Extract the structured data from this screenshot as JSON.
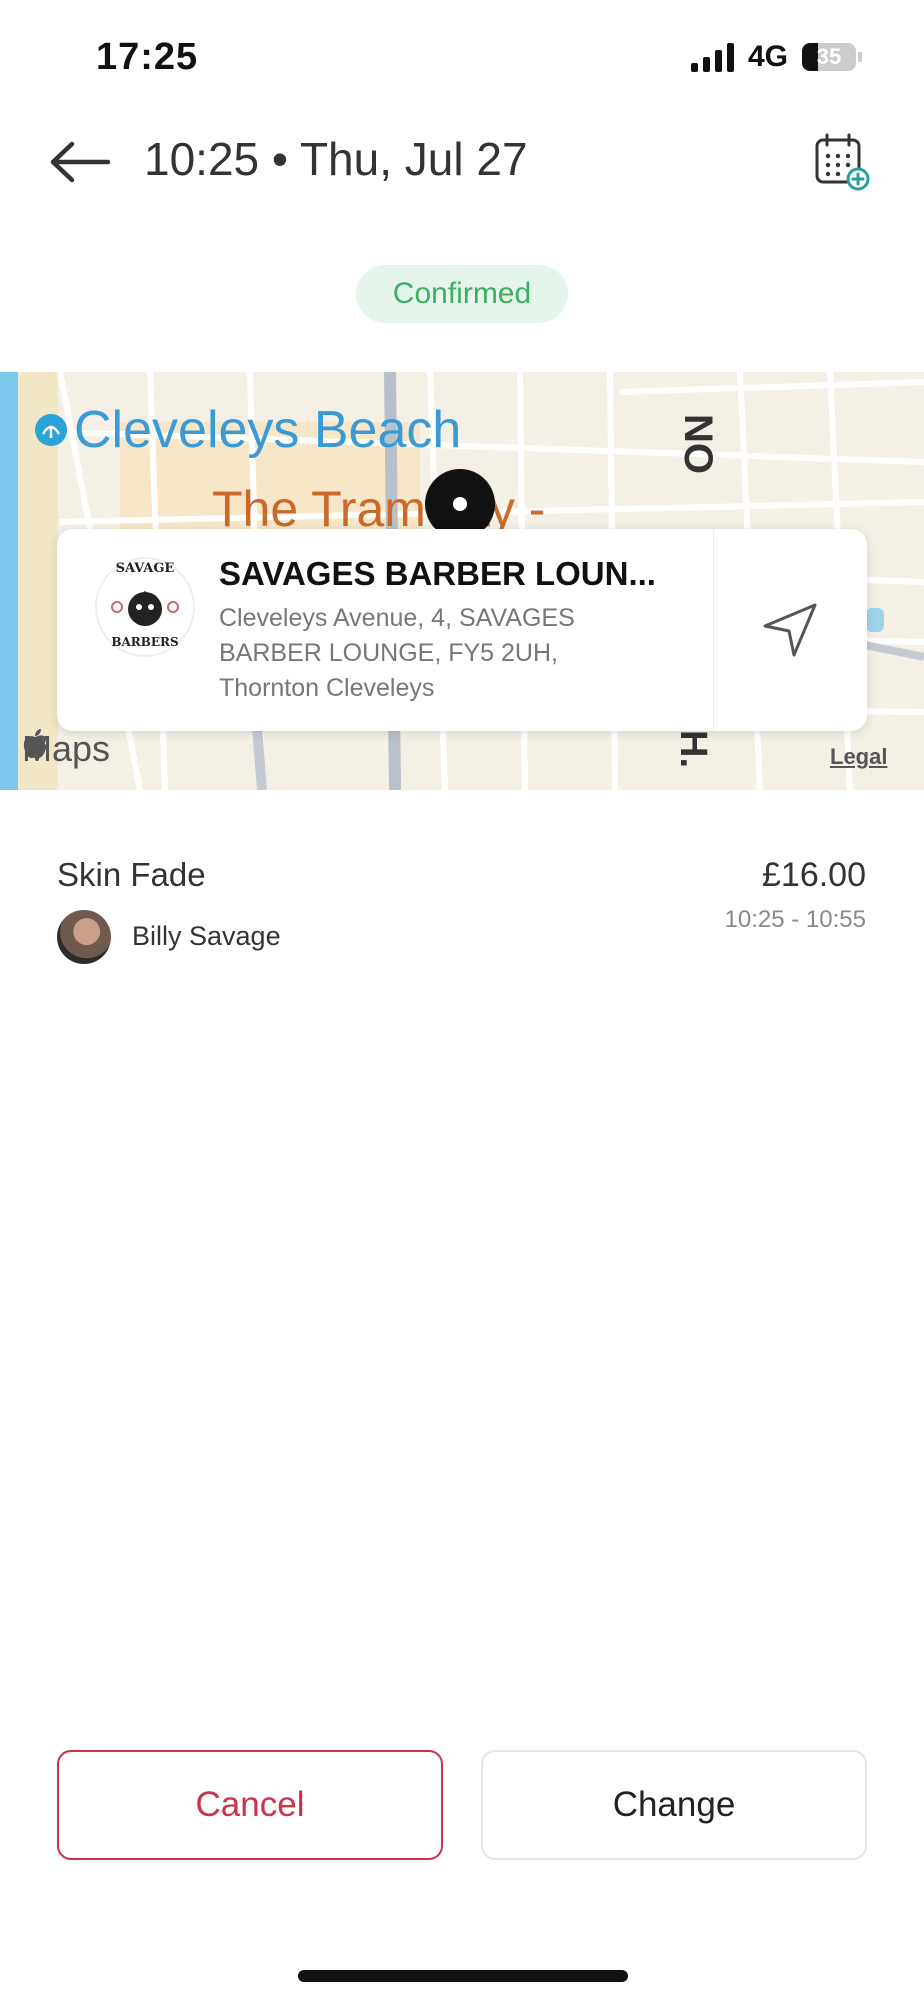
{
  "status_bar": {
    "time": "17:25",
    "network": "4G",
    "battery": "35"
  },
  "header": {
    "title": "10:25 • Thu, Jul 27",
    "back_icon": "arrow-left-icon",
    "calendar_icon": "calendar-add-icon"
  },
  "status_badge": {
    "label": "Confirmed",
    "color": "#3dae64"
  },
  "map": {
    "labels": {
      "beach": "Cleveleys Beach",
      "street": "The Tramway -",
      "road_right": "NO",
      "road_bottom": "H."
    },
    "pin_icon": "map-pin-icon",
    "attribution": "Maps",
    "legal": "Legal"
  },
  "location_card": {
    "name": "SAVAGES BARBER LOUN...",
    "address": "Cleveleys Avenue, 4, SAVAGES BARBER LOUNGE, FY5 2UH, Thornton Cleveleys",
    "logo_text_top": "SAVAGE",
    "logo_text_bottom": "BARBERS",
    "nav_icon": "navigation-arrow-icon"
  },
  "service": {
    "name": "Skin Fade",
    "price": "£16.00",
    "time": "10:25 - 10:55",
    "staff": "Billy Savage"
  },
  "actions": {
    "cancel": "Cancel",
    "change": "Change",
    "cancel_color": "#c8344a"
  }
}
